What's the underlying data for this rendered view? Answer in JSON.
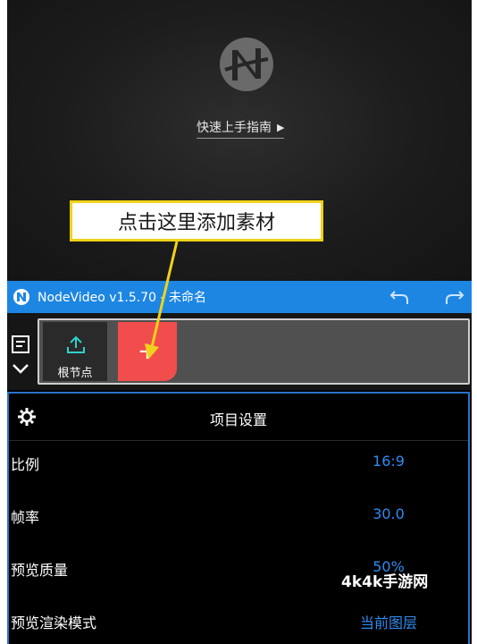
{
  "preview": {
    "guide_link": "快速上手指南",
    "guide_arrow": "▶"
  },
  "callout": {
    "text": "点击这里添加素材"
  },
  "titlebar": {
    "title": "NodeVideo v1.5.70 - 未命名",
    "accent": "#1d86e3"
  },
  "node_strip": {
    "upload_label": "根节点",
    "add_symbol": "+",
    "add_color": "#f24d4d"
  },
  "settings": {
    "title": "项目设置",
    "rows": [
      {
        "label": "比例",
        "value": "16:9"
      },
      {
        "label": "帧率",
        "value": "30.0"
      },
      {
        "label": "预览质量",
        "value": "50%"
      },
      {
        "label": "预览渲染模式",
        "value": "当前图层"
      }
    ],
    "value_color": "#2e8bf0"
  },
  "watermark": "4k4k手游网"
}
